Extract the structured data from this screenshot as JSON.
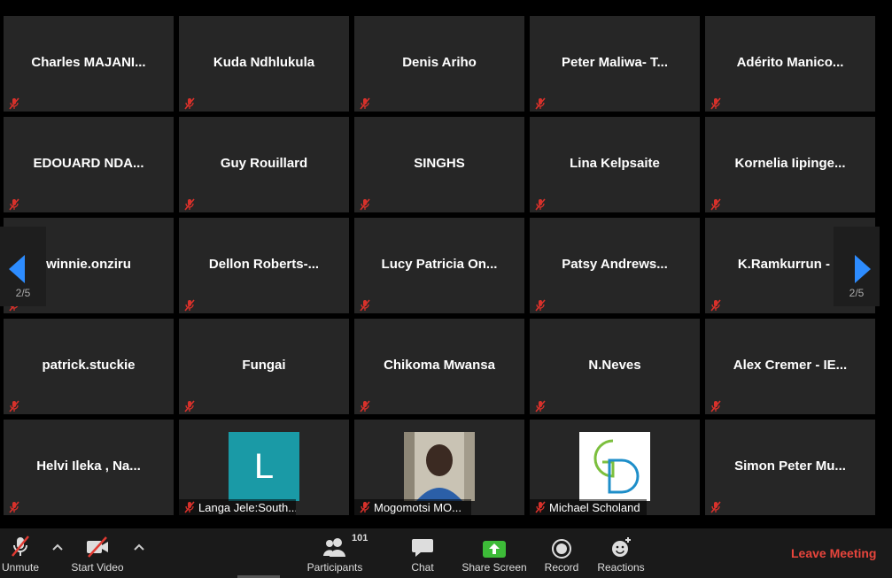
{
  "gallery": {
    "page_indicator": "2/5",
    "rows": [
      [
        {
          "name": "Charles MAJANI..."
        },
        {
          "name": "Kuda Ndhlukula"
        },
        {
          "name": "Denis Ariho"
        },
        {
          "name": "Peter Maliwa- T..."
        },
        {
          "name": "Adérito Manico..."
        }
      ],
      [
        {
          "name": "EDOUARD NDA..."
        },
        {
          "name": "Guy Rouillard"
        },
        {
          "name": "SINGHS"
        },
        {
          "name": "Lina Kelpsaite"
        },
        {
          "name": "Kornelia Iipinge..."
        }
      ],
      [
        {
          "name": "winnie.onziru"
        },
        {
          "name": "Dellon Roberts-..."
        },
        {
          "name": "Lucy Patricia On..."
        },
        {
          "name": "Patsy Andrews..."
        },
        {
          "name": "K.Ramkurrun - E"
        }
      ],
      [
        {
          "name": "patrick.stuckie"
        },
        {
          "name": "Fungai"
        },
        {
          "name": "Chikoma Mwansa"
        },
        {
          "name": "N.Neves"
        },
        {
          "name": "Alex Cremer - IE..."
        }
      ],
      [
        {
          "name": "Helvi Ileka , Na..."
        },
        {
          "footer_name": "Langa Jele:South...",
          "avatar": "letter",
          "letter": "L"
        },
        {
          "footer_name": "Mogomotsi MO...",
          "avatar": "photo"
        },
        {
          "footer_name": "Michael Scholand",
          "avatar": "logo"
        },
        {
          "name": "Simon Peter Mu..."
        }
      ]
    ]
  },
  "toolbar": {
    "unmute_label": "Unmute",
    "start_video_label": "Start Video",
    "participants_label": "Participants",
    "participants_count": "101",
    "chat_label": "Chat",
    "share_screen_label": "Share Screen",
    "record_label": "Record",
    "reactions_label": "Reactions",
    "leave_label": "Leave Meeting"
  },
  "colors": {
    "tile_bg": "#262626",
    "mute_red": "#d8312b",
    "share_green": "#3dbb38",
    "leave_red": "#e8453c",
    "nav_blue": "#2d8cff",
    "avatar_teal": "#1a9aa6"
  },
  "icons": {
    "mute": "muted-mic-icon",
    "video_off": "video-off-icon",
    "participants": "participants-icon",
    "chat": "chat-bubble-icon",
    "share": "share-screen-icon",
    "record": "record-icon",
    "reactions": "reaction-emoji-icon",
    "caret": "chevron-up-icon",
    "nav_left": "previous-page-arrow-icon",
    "nav_right": "next-page-arrow-icon"
  }
}
